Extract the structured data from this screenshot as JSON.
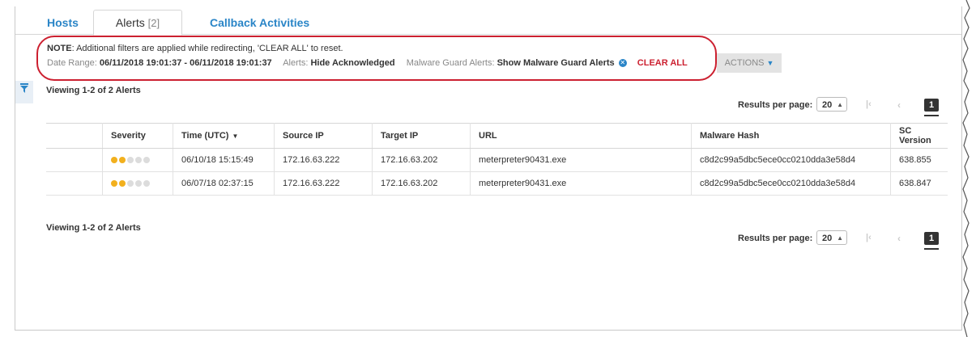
{
  "tabs": {
    "hosts": "Hosts",
    "alerts": "Alerts",
    "alerts_count": "[2]",
    "callback": "Callback Activities"
  },
  "note": {
    "prefix": "NOTE",
    "text": ": Additional filters are applied while redirecting, 'CLEAR ALL' to reset.",
    "date_range_label": "Date Range:",
    "date_range_value": "06/11/2018 19:01:37 - 06/11/2018 19:01:37",
    "alerts_label": "Alerts:",
    "alerts_value": "Hide Acknowledged",
    "mg_label": "Malware Guard Alerts:",
    "mg_value": "Show Malware Guard Alerts",
    "clear_all": "CLEAR ALL"
  },
  "actions": {
    "label": "ACTIONS"
  },
  "viewing": "Viewing 1-2 of 2 Alerts",
  "pager": {
    "label": "Results per page:",
    "per_page": "20",
    "current_page": "1"
  },
  "table": {
    "headers": {
      "severity": "Severity",
      "time": "Time (UTC)",
      "source_ip": "Source IP",
      "target_ip": "Target IP",
      "url": "URL",
      "hash": "Malware Hash",
      "sc_version": "SC Version"
    },
    "rows": [
      {
        "severity": 2,
        "time": "06/10/18 15:15:49",
        "source_ip": "172.16.63.222",
        "target_ip": "172.16.63.202",
        "url": "meterpreter90431.exe",
        "hash": "c8d2c99a5dbc5ece0cc0210dda3e58d4",
        "sc_version": "638.855"
      },
      {
        "severity": 2,
        "time": "06/07/18 02:37:15",
        "source_ip": "172.16.63.222",
        "target_ip": "172.16.63.202",
        "url": "meterpreter90431.exe",
        "hash": "c8d2c99a5dbc5ece0cc0210dda3e58d4",
        "sc_version": "638.847"
      }
    ]
  },
  "colors": {
    "accent": "#2a85c7",
    "highlight": "#cc2030",
    "severity_on": "#f2b01e",
    "severity_off": "#dcdcdc"
  }
}
